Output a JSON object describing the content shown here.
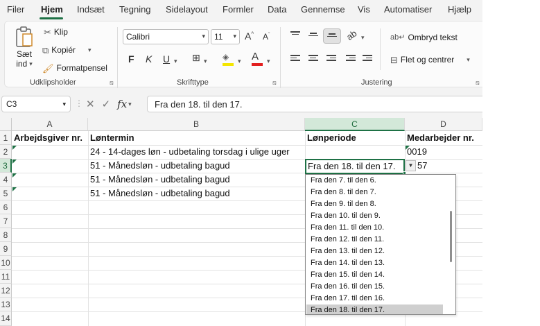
{
  "menu": {
    "items": [
      "Filer",
      "Hjem",
      "Indsæt",
      "Tegning",
      "Sidelayout",
      "Formler",
      "Data",
      "Gennemse",
      "Vis",
      "Automatiser",
      "Hjælp"
    ],
    "active": "Hjem"
  },
  "ribbon": {
    "clipboard": {
      "paste_label": "Sæt",
      "paste_label2": "ind",
      "cut": "Klip",
      "copy": "Kopiér",
      "format_painter": "Formatpensel",
      "group_label": "Udklipsholder"
    },
    "font": {
      "font_name": "Calibri",
      "font_size": "11",
      "bold": "F",
      "italic": "K",
      "underline": "U",
      "group_label": "Skrifttype"
    },
    "alignment": {
      "wrap_text": "Ombryd tekst",
      "merge_center": "Flet og centrer",
      "group_label": "Justering"
    }
  },
  "formula_bar": {
    "name_box": "C3",
    "fx": "fx",
    "content": "Fra den 18. til den 17."
  },
  "grid": {
    "columns": [
      "A",
      "B",
      "C",
      "D"
    ],
    "rows": [
      "1",
      "2",
      "3",
      "4",
      "5",
      "6",
      "7",
      "8",
      "9",
      "10",
      "11",
      "12",
      "13",
      "14"
    ],
    "cells": {
      "A1": "Arbejdsgiver nr.",
      "B1": "Løntermin",
      "C1": "Lønperiode",
      "D1": "Medarbejder nr.",
      "B2": "24 - 14-dages løn - udbetaling torsdag i ulige uger",
      "D2": "0019",
      "B3": "51 - Månedsløn - udbetaling bagud",
      "C3": "Fra den 18. til den 17.",
      "D3": "57",
      "B4": "51 - Månedsløn - udbetaling bagud",
      "B5": "51 - Månedsløn - udbetaling bagud"
    }
  },
  "dropdown": {
    "options": [
      "Fra den 7. til den 6.",
      "Fra den 8. til den 7.",
      "Fra den 9. til den 8.",
      "Fra den 10. til den 9.",
      "Fra den 11. til den 10.",
      "Fra den 12. til den 11.",
      "Fra den 13. til den 12.",
      "Fra den 14. til den 13.",
      "Fra den 15. til den 14.",
      "Fra den 16. til den 15.",
      "Fra den 17. til den 16.",
      "Fra den 18. til den 17."
    ],
    "selected": "Fra den 18. til den 17."
  },
  "colors": {
    "accent": "#1e7145",
    "header_selected": "#d3e8d9"
  }
}
